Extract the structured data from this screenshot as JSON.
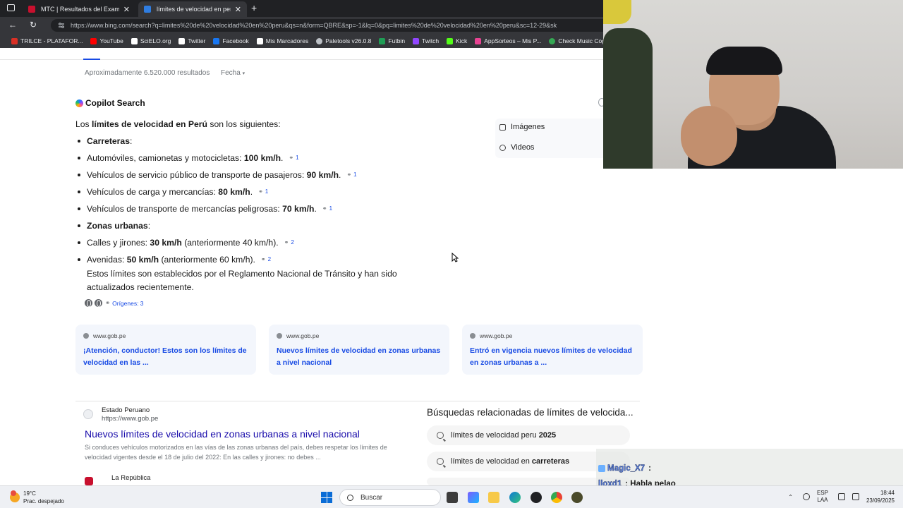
{
  "browser": {
    "tabs": [
      {
        "title": "MTC | Resultados del Examen de",
        "active": false
      },
      {
        "title": "límites de velocidad en peru - Bú",
        "active": true
      }
    ],
    "url": "https://www.bing.com/search?q=limites%20de%20velocidad%20en%20peru&qs=n&form=QBRE&sp=-1&lq=0&pq=limites%20de%20velocidad%20en%20peru&sc=12-29&sk",
    "bookmarks": [
      {
        "label": "TRILCE - PLATAFOR...",
        "color": "#d93025"
      },
      {
        "label": "YouTube",
        "color": "#ff0000"
      },
      {
        "label": "SciELO.org",
        "color": "#ffffff"
      },
      {
        "label": "Twitter",
        "color": "#ffffff"
      },
      {
        "label": "Facebook",
        "color": "#1877f2"
      },
      {
        "label": "Mis Marcadores",
        "color": "#ffffff"
      },
      {
        "label": "Paletools v26.0.8",
        "color": "#bdc1c6"
      },
      {
        "label": "Futbin",
        "color": "#1f9d55"
      },
      {
        "label": "Twitch",
        "color": "#9146ff"
      },
      {
        "label": "Kick",
        "color": "#53fc18"
      },
      {
        "label": "AppSorteos – Mis P...",
        "color": "#e84393"
      },
      {
        "label": "Check Music Copyri",
        "color": "#34a853"
      }
    ]
  },
  "search": {
    "results_count": "Aproximadamente 6.520.000 resultados",
    "date_filter": "Fecha"
  },
  "copilot": {
    "header": "Copilot Search",
    "intro_pre": "Los ",
    "intro_bold": "límites de velocidad en Perú",
    "intro_post": " son los siguientes:",
    "carreteras": "Carreteras",
    "zonas": "Zonas urbanas",
    "items": [
      {
        "pre": "Automóviles, camionetas y motocicletas: ",
        "bold": "100 km/h",
        "post": ".",
        "cite": "1"
      },
      {
        "pre": "Vehículos de servicio público de transporte de pasajeros: ",
        "bold": "90 km/h",
        "post": ".",
        "cite": "1"
      },
      {
        "pre": "Vehículos de carga y mercancías: ",
        "bold": "80 km/h",
        "post": ".",
        "cite": "1"
      },
      {
        "pre": "Vehículos de transporte de mercancías peligrosas: ",
        "bold": "70 km/h",
        "post": ".",
        "cite": "1"
      },
      {
        "pre": "Calles y jirones: ",
        "bold": "30 km/h",
        "post": " (anteriormente 40 km/h).",
        "cite": "2"
      },
      {
        "pre": "Avenidas: ",
        "bold": "50 km/h",
        "post": " (anteriormente 60 km/h).",
        "cite": "2"
      }
    ],
    "note": "Estos límites son establecidos por el Reglamento Nacional de Tránsito y han sido actualizados recientemente.",
    "origins": "Orígenes: 3"
  },
  "sidebar": {
    "images": "Imágenes",
    "videos": "Videos"
  },
  "cards": [
    {
      "domain": "www.gob.pe",
      "title": "¡Atención, conductor! Estos son los límites de velocidad en las ..."
    },
    {
      "domain": "www.gob.pe",
      "title": "Nuevos límites de velocidad en zonas urbanas a nivel nacional"
    },
    {
      "domain": "www.gob.pe",
      "title": "Entró en vigencia nuevos límites de velocidad en zonas urbanas a ..."
    }
  ],
  "result": {
    "site_name": "Estado Peruano",
    "site_url": "https://www.gob.pe",
    "title": "Nuevos límites de velocidad en zonas urbanas a nivel nacional",
    "desc": "Si conduces vehículos motorizados en las vías de las zonas urbanas del país, debes respetar los límites de velocidad vigentes desde el 18 de julio del 2022: En las calles y jirones: no debes ..."
  },
  "result2": {
    "site_name": "La República"
  },
  "related": {
    "header": "Búsquedas relacionadas de límites de velocida...",
    "items": [
      {
        "pre": "límites de velocidad peru ",
        "bold": "2025"
      },
      {
        "pre": "límites de velocidad en ",
        "bold": "carreteras"
      }
    ]
  },
  "chat": [
    {
      "user": "Magic_X7",
      "msg": ":",
      "badge": "#6bb0ff"
    },
    {
      "user": "lloxd1",
      "msg": ": Habla pelao",
      "badge": "#8fa2c7"
    },
    {
      "user": "lloxd1",
      "msg": ":",
      "badge": "#8fa2c7"
    }
  ],
  "taskbar": {
    "temp": "19°C",
    "weather": "Prac. despejado",
    "search": "Buscar",
    "lang1": "ESP",
    "lang2": "LAA",
    "time": "18:44",
    "date": "23/09/2025"
  }
}
